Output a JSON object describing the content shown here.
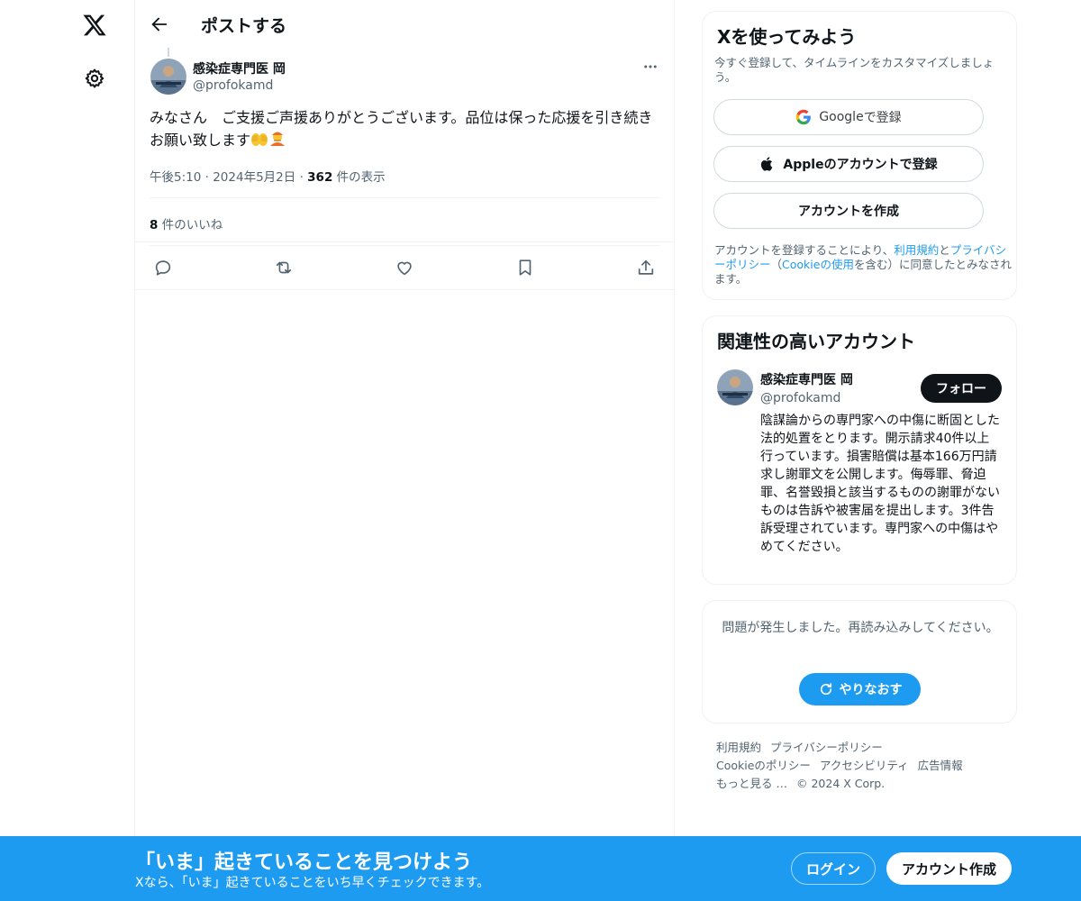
{
  "header": {
    "title": "ポストする"
  },
  "post": {
    "author_name": "感染症専門医 岡",
    "author_handle": "@profokamd",
    "text": "みなさん　ご支援ご声援ありがとうございます。品位は保った応援を引き続きお願い致します",
    "time": "午後5:10",
    "date": "2024年5月2日",
    "views_count": "362",
    "views_label": " 件の表示",
    "likes_count": "8",
    "likes_label": " 件のいいね"
  },
  "signup_card": {
    "title": "Xを使ってみよう",
    "subtitle": "今すぐ登録して、タイムラインをカスタマイズしましょう。",
    "google_label_a": "Google",
    "google_label_b": " で登録",
    "apple_label": "Appleのアカウントで登録",
    "create_label": "アカウントを作成",
    "tos_prefix": "アカウントを登録することにより、",
    "tos_link1": "利用規約",
    "tos_and": "と",
    "tos_link2": "プライバシーポリシー",
    "tos_mid": "（",
    "tos_link3": "Cookieの使用",
    "tos_suffix": "を含む）に同意したとみなされます。"
  },
  "related_card": {
    "title": "関連性の高いアカウント",
    "name": "感染症専門医 岡",
    "handle": "@profokamd",
    "follow_label": "フォロー",
    "bio": "陰謀論からの専門家への中傷に断固とした法的処置をとります。開示請求40件以上行っています。損害賠償は基本166万円請求し謝罪文を公開します。侮辱罪、脅迫罪、名誉毀損と該当するものの謝罪がないものは告訴や被害届を提出します。3件告訴受理されています。専門家への中傷はやめてください。"
  },
  "error_card": {
    "message": "問題が発生しました。再読み込みしてください。",
    "retry_label": "やりなおす"
  },
  "footer": {
    "terms": "利用規約",
    "privacy": "プライバシーポリシー",
    "cookie": "Cookieのポリシー",
    "accessibility": "アクセシビリティ",
    "ads": "広告情報",
    "more": "もっと見る …",
    "copyright": "© 2024 X Corp."
  },
  "banner": {
    "title": "「いま」起きていることを見つけよう",
    "subtitle": "Xなら、「いま」起きていることをいち早くチェックできます。",
    "login_label": "ログイン",
    "signup_label": "アカウント作成"
  },
  "colors": {
    "accent": "#1d9bf0",
    "text": "#0f1419",
    "muted": "#536471"
  }
}
